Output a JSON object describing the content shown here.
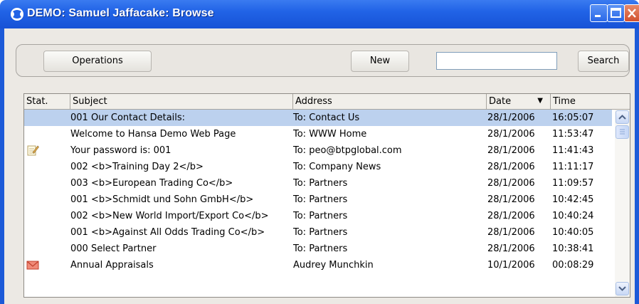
{
  "window": {
    "title": "DEMO: Samuel Jaffacake: Browse",
    "controls": [
      "minimize-icon",
      "maximize-icon",
      "close-icon"
    ],
    "colors": {
      "titlebar": "#2163e6",
      "selected_row": "#bcd1ee",
      "frame": "#1c5ad8"
    }
  },
  "toolbar": {
    "operations_label": "Operations",
    "new_label": "New",
    "search_value": "",
    "search_label": "Search"
  },
  "table": {
    "columns": [
      "Stat.",
      "Subject",
      "Address",
      "Date",
      "Time"
    ],
    "sort_column": "Date",
    "sort_direction": "descending",
    "rows": [
      {
        "status": "",
        "subject": "001 Our Contact Details:",
        "address": "To: Contact Us",
        "date": "28/1/2006",
        "time": "16:05:07",
        "selected": true
      },
      {
        "status": "",
        "subject": "Welcome to Hansa Demo Web Page",
        "address": "To: WWW Home",
        "date": "28/1/2006",
        "time": "11:53:47"
      },
      {
        "status": "edit-note-icon",
        "subject": "Your password is: 001",
        "address": "To: peo@btpglobal.com",
        "date": "28/1/2006",
        "time": "11:41:43"
      },
      {
        "status": "",
        "subject": "002 <b>Training Day 2</b>",
        "address": "To: Company News",
        "date": "28/1/2006",
        "time": "11:11:17"
      },
      {
        "status": "",
        "subject": "003 <b>European Trading Co</b>",
        "address": "To: Partners",
        "date": "28/1/2006",
        "time": "11:09:57"
      },
      {
        "status": "",
        "subject": "001 <b>Schmidt und Sohn GmbH</b>",
        "address": "To: Partners",
        "date": "28/1/2006",
        "time": "10:42:45"
      },
      {
        "status": "",
        "subject": "002 <b>New World Import/Export Co</b>",
        "address": "To: Partners",
        "date": "28/1/2006",
        "time": "10:40:24"
      },
      {
        "status": "",
        "subject": "001 <b>Against All Odds Trading Co</b>",
        "address": "To: Partners",
        "date": "28/1/2006",
        "time": "10:40:05"
      },
      {
        "status": "",
        "subject": "000 Select Partner",
        "address": "To: Partners",
        "date": "28/1/2006",
        "time": "10:38:41"
      },
      {
        "status": "mail-envelope-icon",
        "subject": "Annual Appraisals",
        "address": "Audrey Munchkin",
        "date": "10/1/2006",
        "time": "00:08:29"
      }
    ]
  }
}
